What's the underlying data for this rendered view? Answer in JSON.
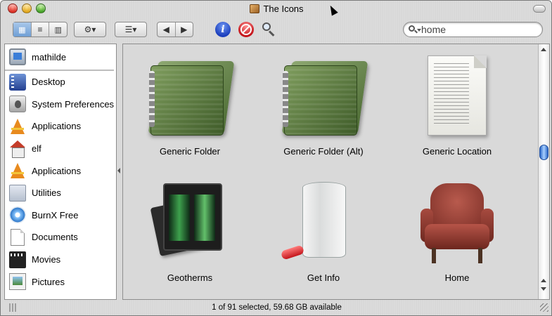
{
  "window": {
    "title": "The Icons",
    "status_text": "1 of 91 selected, 59.68 GB available"
  },
  "toolbar": {
    "view_modes": [
      {
        "name": "icon-view",
        "icon": "icon-grid-icon",
        "active": true
      },
      {
        "name": "list-view",
        "icon": "list-icon",
        "active": false
      },
      {
        "name": "column-view",
        "icon": "columns-icon",
        "active": false
      }
    ],
    "action_icon": "⚙▾",
    "arrange_icon": "☰▾",
    "nav_back": "◀",
    "nav_forward": "▶",
    "info_glyph": "i"
  },
  "search": {
    "value": "home"
  },
  "sidebar": {
    "user": {
      "label": "mathilde",
      "icon": "computer-icon"
    },
    "items": [
      {
        "label": "Desktop",
        "icon": "desktop-icon"
      },
      {
        "label": "System Preferences",
        "icon": "system-preferences-icon"
      },
      {
        "label": "Applications",
        "icon": "applications-icon"
      },
      {
        "label": "elf",
        "icon": "home-icon"
      },
      {
        "label": "Applications",
        "icon": "applications-icon"
      },
      {
        "label": "Utilities",
        "icon": "utilities-folder-icon"
      },
      {
        "label": "BurnX Free",
        "icon": "burnx-icon"
      },
      {
        "label": "Documents",
        "icon": "documents-icon"
      },
      {
        "label": "Movies",
        "icon": "movies-icon"
      },
      {
        "label": "Pictures",
        "icon": "pictures-icon"
      }
    ]
  },
  "files": [
    {
      "label": "Generic Folder",
      "icon": "green-folder-icon"
    },
    {
      "label": "Generic Folder (Alt)",
      "icon": "green-folder-icon"
    },
    {
      "label": "Generic Location",
      "icon": "document-page-icon"
    },
    {
      "label": "Geotherms",
      "icon": "film-slides-icon"
    },
    {
      "label": "Get Info",
      "icon": "glass-and-pill-icon"
    },
    {
      "label": "Home",
      "icon": "armchair-icon"
    }
  ],
  "colors": {
    "selection_blue": "#6f9fd5",
    "scroll_thumb": "#2a66c8"
  }
}
